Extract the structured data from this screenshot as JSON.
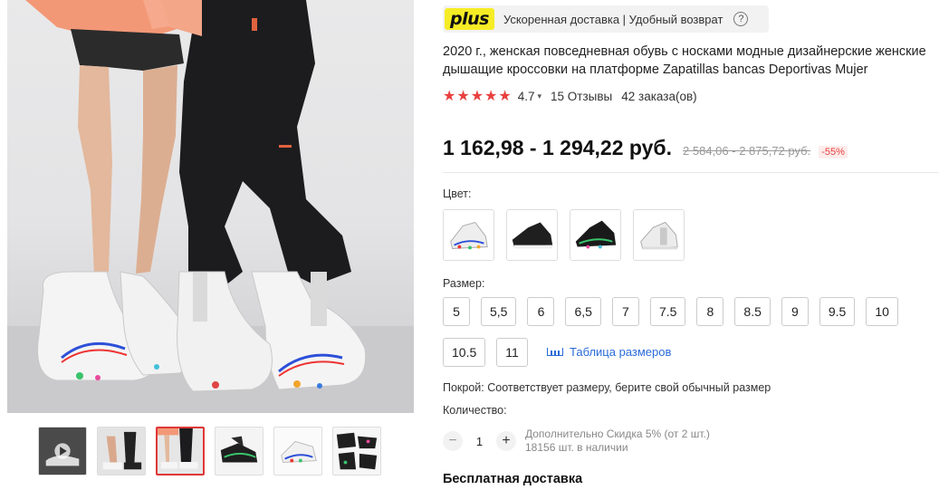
{
  "plus_banner": {
    "logo": "plus",
    "text": "Ускоренная доставка | Удобный возврат",
    "help_glyph": "?"
  },
  "product": {
    "title": "2020 г., женская повседневная обувь с носками модные дизайнерские женские дышащие кроссовки на платформе Zapatillas bancas Deportivas Mujer",
    "stars": "★★★★★",
    "rating": "4.7",
    "reviews": "15 Отзывы",
    "orders": "42 заказа(ов)",
    "price": "1 162,98 - 1 294,22 руб.",
    "old_price": "2 584,06 - 2 875,72 руб.",
    "discount": "-55%"
  },
  "color_label": "Цвет:",
  "size_label": "Размер:",
  "sizes_row1": [
    "5",
    "5,5",
    "6",
    "6,5",
    "7",
    "7.5",
    "8",
    "8.5",
    "9",
    "9.5",
    "10"
  ],
  "sizes_row2": [
    "10.5",
    "11"
  ],
  "size_chart_link": "Таблица размеров",
  "fit_text": "Покрой: Соответствует размеру, берите свой обычный размер",
  "quantity": {
    "label": "Количество:",
    "minus": "−",
    "value": "1",
    "plus": "+",
    "discount_info": "Дополнительно Скидка 5% (от 2 шт.)",
    "stock_info": "18156 шт. в наличии"
  },
  "shipping_title": "Бесплатная доставка",
  "colors": {
    "accent": "#e8403f",
    "plus_yellow": "#f6ec25",
    "link_blue": "#2a6bd8"
  }
}
